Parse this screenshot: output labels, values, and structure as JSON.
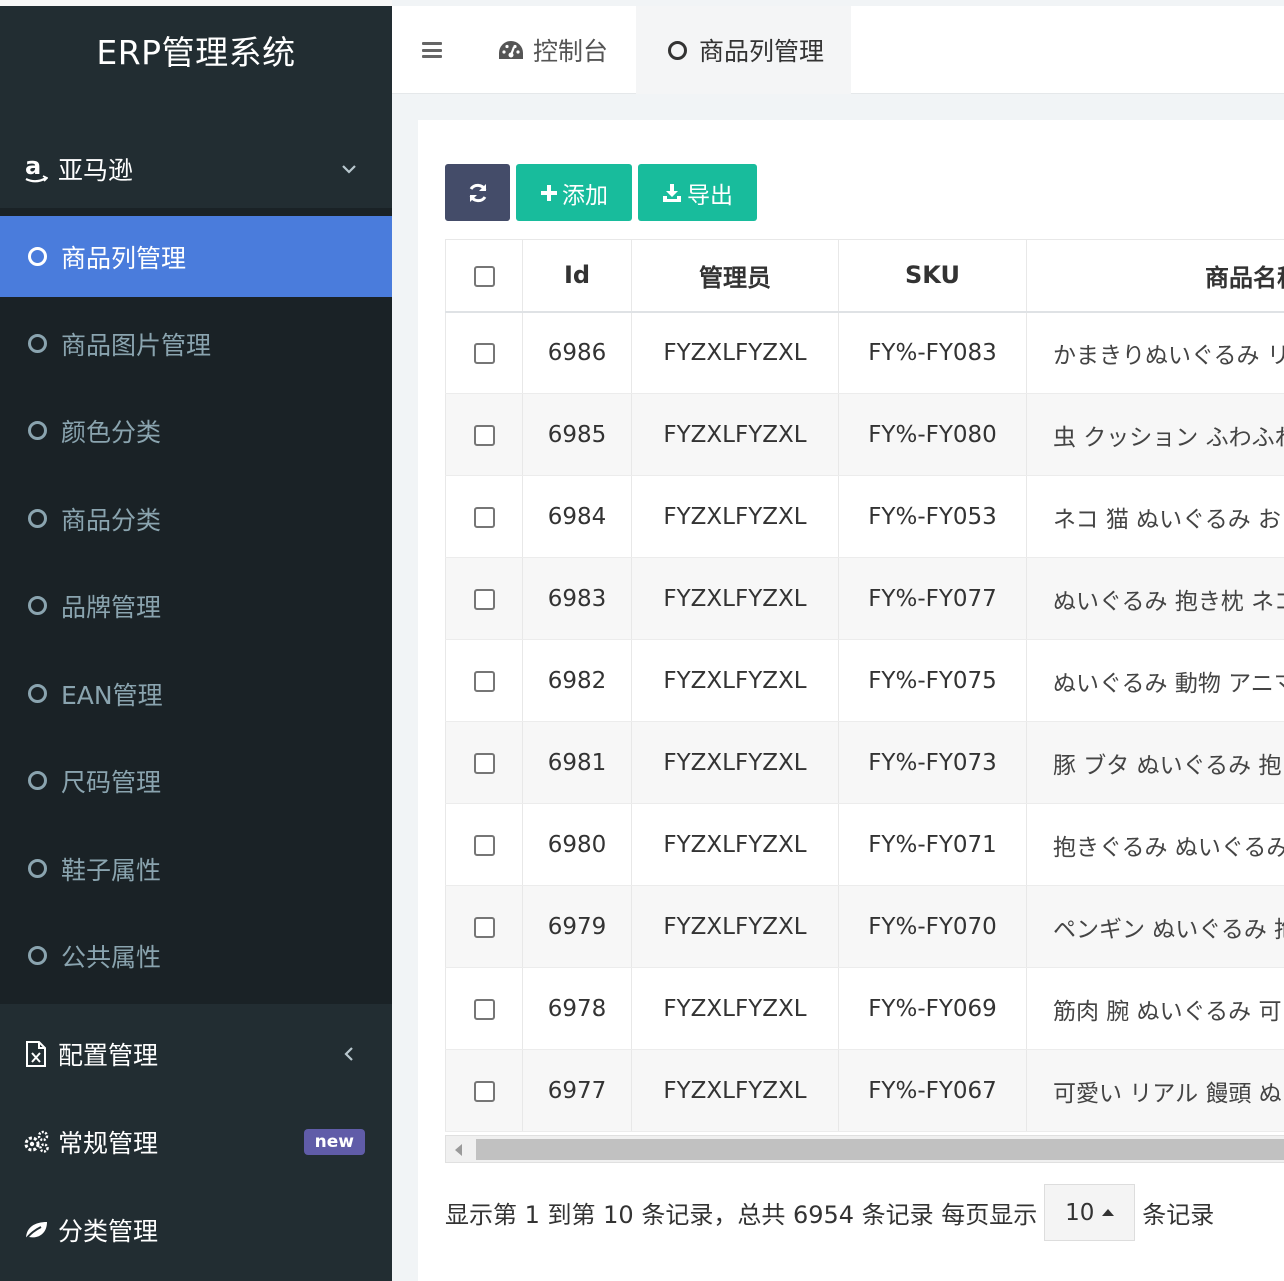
{
  "app": {
    "title": "ERP管理系统"
  },
  "sidebar": {
    "amazon": {
      "label": "亚马逊"
    },
    "submenu": [
      {
        "label": "商品列管理",
        "active": true
      },
      {
        "label": "商品图片管理"
      },
      {
        "label": "颜色分类"
      },
      {
        "label": "商品分类"
      },
      {
        "label": "品牌管理"
      },
      {
        "label": "EAN管理"
      },
      {
        "label": "尺码管理"
      },
      {
        "label": "鞋子属性"
      },
      {
        "label": "公共属性"
      }
    ],
    "config": {
      "label": "配置管理"
    },
    "general": {
      "label": "常规管理",
      "badge": "new"
    },
    "category": {
      "label": "分类管理"
    }
  },
  "navbar": {
    "tabs": [
      {
        "label": "控制台",
        "icon": "dashboard-icon"
      },
      {
        "label": "商品列管理",
        "icon": "circle-icon",
        "active": true
      }
    ]
  },
  "toolbar": {
    "add_label": "添加",
    "export_label": "导出"
  },
  "table": {
    "columns": [
      "Id",
      "管理员",
      "SKU",
      "商品名称"
    ],
    "rows": [
      {
        "id": "6986",
        "admin": "FYZXLFYZXL",
        "sku": "FY%-FY083",
        "name": "かまきりぬいぐるみ リ"
      },
      {
        "id": "6985",
        "admin": "FYZXLFYZXL",
        "sku": "FY%-FY080",
        "name": "虫 クッション ふわふわ"
      },
      {
        "id": "6984",
        "admin": "FYZXLFYZXL",
        "sku": "FY%-FY053",
        "name": "ネコ 猫 ぬいぐるみ お"
      },
      {
        "id": "6983",
        "admin": "FYZXLFYZXL",
        "sku": "FY%-FY077",
        "name": "ぬいぐるみ 抱き枕 ネコ"
      },
      {
        "id": "6982",
        "admin": "FYZXLFYZXL",
        "sku": "FY%-FY075",
        "name": "ぬいぐるみ 動物 アニマ"
      },
      {
        "id": "6981",
        "admin": "FYZXLFYZXL",
        "sku": "FY%-FY073",
        "name": "豚 ブタ ぬいぐるみ 抱"
      },
      {
        "id": "6980",
        "admin": "FYZXLFYZXL",
        "sku": "FY%-FY071",
        "name": "抱きぐるみ ぬいぐるみ"
      },
      {
        "id": "6979",
        "admin": "FYZXLFYZXL",
        "sku": "FY%-FY070",
        "name": "ペンギン ぬいぐるみ 抱"
      },
      {
        "id": "6978",
        "admin": "FYZXLFYZXL",
        "sku": "FY%-FY069",
        "name": "筋肉 腕 ぬいぐるみ 可"
      },
      {
        "id": "6977",
        "admin": "FYZXLFYZXL",
        "sku": "FY%-FY067",
        "name": "可愛い リアル 饅頭 ぬ"
      }
    ]
  },
  "pagination": {
    "summary": "显示第 1 到第 10 条记录，总共 6954 条记录 每页显示",
    "page_size": "10",
    "suffix": "条记录"
  },
  "colors": {
    "sidebar_bg": "#222d32",
    "submenu_bg": "#1a2226",
    "active_item": "#4a7cdc",
    "success": "#18bc9c",
    "refresh_button": "#444c69",
    "badge": "#605ca8"
  }
}
